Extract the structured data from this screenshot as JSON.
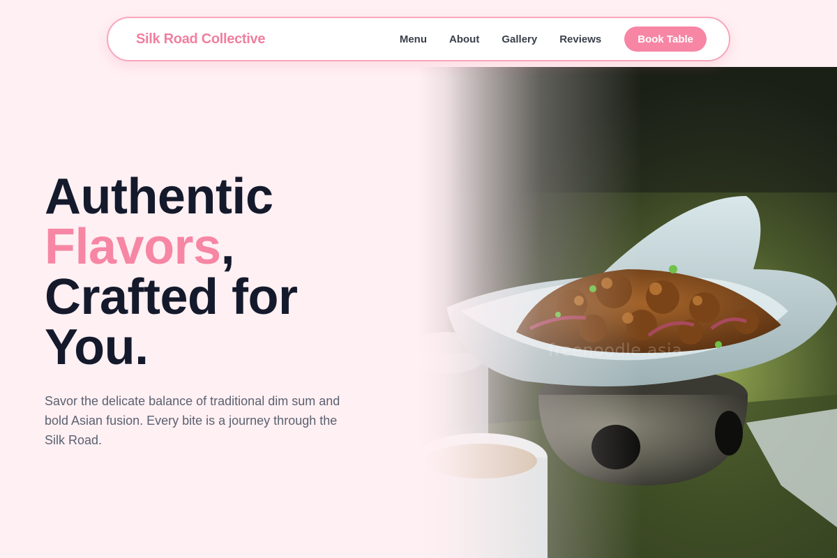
{
  "nav": {
    "brand": "Silk Road Collective",
    "links": [
      {
        "label": "Menu"
      },
      {
        "label": "About"
      },
      {
        "label": "Gallery"
      },
      {
        "label": "Reviews"
      }
    ],
    "cta": "Book Table"
  },
  "hero": {
    "title_line1": "Authentic",
    "title_accent": "Flavors",
    "title_comma": ",",
    "title_line3": "Crafted for",
    "title_line4": "You.",
    "subtitle": "Savor the delicate balance of traditional dim sum and bold Asian fusion. Every bite is a journey through the Silk Road.",
    "image_watermark": "freenoodle.asia"
  },
  "colors": {
    "background": "#fff0f3",
    "accent": "#f686a4",
    "brand": "#f07fa0",
    "heading": "#141a2b",
    "body_text": "#5b6170"
  }
}
